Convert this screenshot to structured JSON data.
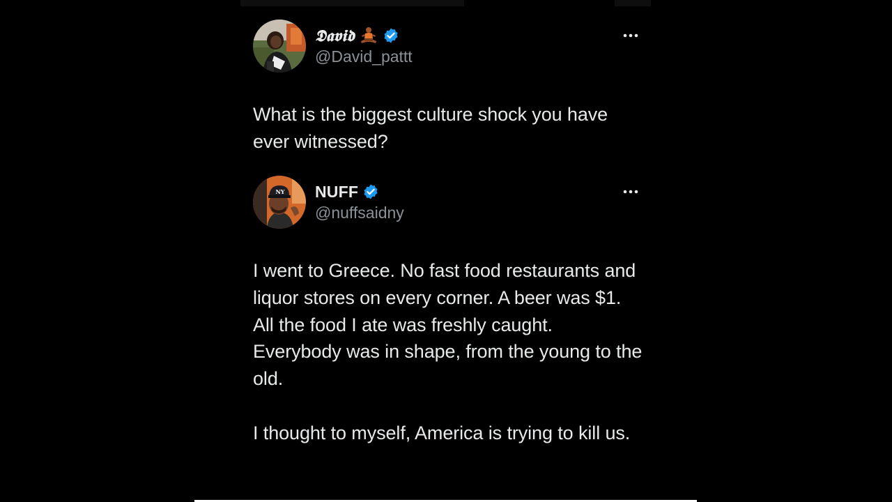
{
  "tweets": [
    {
      "display_name": "𝕯𝖆𝖛𝖎𝖉",
      "name_emoji": "person-in-lotus-position-icon",
      "verified": true,
      "handle": "@David_pattt",
      "text": "What is the biggest culture shock you have ever witnessed?"
    },
    {
      "display_name": "NUFF",
      "verified": true,
      "handle": "@nuffsaidny",
      "text_p1": "I went to Greece. No fast food restaurants and liquor stores on every corner. A beer was $1. All the food I ate was freshly caught. Everybody was in shape, from the young to the old.",
      "text_p2": "I thought to myself, America is trying to kill us."
    }
  ],
  "colors": {
    "background": "#000000",
    "text": "#e7e9ea",
    "secondary_text": "#8b9197",
    "verified_badge": "#1d9bf0"
  }
}
